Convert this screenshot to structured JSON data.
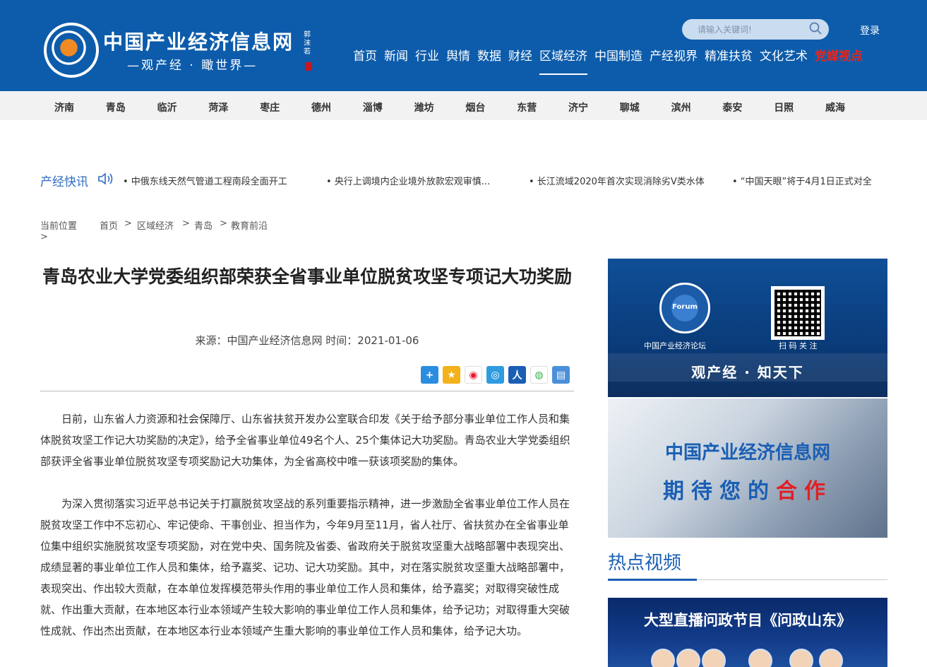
{
  "header": {
    "logo_title": "中国产业经济信息网",
    "logo_subtitle": "—观产经 · 瞰世界—",
    "logo_seal": "郭沫若",
    "search_placeholder": "请输入关键词!",
    "login": "登录",
    "nav": [
      {
        "label": "首页"
      },
      {
        "label": "新闻"
      },
      {
        "label": "行业"
      },
      {
        "label": "舆情"
      },
      {
        "label": "数据"
      },
      {
        "label": "财经"
      },
      {
        "label": "区域经济",
        "active": true
      },
      {
        "label": "中国制造"
      },
      {
        "label": "产经视界"
      },
      {
        "label": "精准扶贫"
      },
      {
        "label": "文化艺术"
      },
      {
        "label": "党媒视点",
        "hot": true
      }
    ]
  },
  "subnav": [
    "济南",
    "青岛",
    "临沂",
    "菏泽",
    "枣庄",
    "德州",
    "淄博",
    "潍坊",
    "烟台",
    "东营",
    "济宁",
    "聊城",
    "滨州",
    "泰安",
    "日照",
    "威海"
  ],
  "ticker": {
    "label": "产经快讯",
    "items": [
      "• 中俄东线天然气管道工程南段全面开工",
      "• 央行上调境内企业境外放款宏观审慎...",
      "• 长江流域2020年首次实现消除劣Ⅴ类水体",
      "• “中国天眼”将于4月1日正式对全"
    ]
  },
  "breadcrumb": {
    "label": "当前位置",
    "items": [
      "首页",
      ">",
      "区域经济",
      ">",
      "青岛",
      ">",
      "教育前沿"
    ],
    "trailing": ">"
  },
  "article": {
    "title": "青岛农业大学党委组织部荣获全省事业单位脱贫攻坚专项记大功奖励",
    "meta": "来源：中国产业经济信息网   时间：2021-01-06",
    "share_icons": [
      "plus-icon",
      "star-icon",
      "weibo-icon",
      "tencent-icon",
      "renren-icon",
      "wechat-icon",
      "print-icon"
    ],
    "paragraphs": [
      "日前，山东省人力资源和社会保障厅、山东省扶贫开发办公室联合印发《关于给予部分事业单位工作人员和集体脱贫攻坚工作记大功奖励的决定》，给予全省事业单位49名个人、25个集体记大功奖励。青岛农业大学党委组织部获评全省事业单位脱贫攻坚专项奖励记大功集体，为全省高校中唯一获该项奖励的集体。",
      "为深入贯彻落实习近平总书记关于打赢脱贫攻坚战的系列重要指示精神，进一步激励全省事业单位工作人员在脱贫攻坚工作中不忘初心、牢记使命、干事创业、担当作为，今年9月至11月，省人社厅、省扶贫办在全省事业单位集中组织实施脱贫攻坚专项奖励，对在党中央、国务院及省委、省政府关于脱贫攻坚重大战略部署中表现突出、成绩显著的事业单位工作人员和集体，给予嘉奖、记功、记大功奖励。其中，对在落实脱贫攻坚重大战略部署中，表现突出、作出较大贡献，在本单位发挥模范带头作用的事业单位工作人员和集体，给予嘉奖；对取得突破性成就、作出重大贡献，在本地区本行业本领域产生较大影响的事业单位工作人员和集体，给予记功；对取得重大突破性成就、作出杰出贡献，在本地区本行业本领域产生重大影响的事业单位工作人员和集体，给予记大功。"
    ]
  },
  "sidebar": {
    "ad1": {
      "forum_label": "中国产业经济论坛",
      "globe_text": "Forum",
      "qr_label": "扫 码 关 注",
      "slogan": "观产经 · 知天下"
    },
    "ad2": {
      "title": "中国产业经济信息网",
      "slogan_blue": "期待您的",
      "slogan_red": "合作"
    },
    "hot_video_title": "热点视频",
    "video": {
      "title": "大型直播问政节目《问政山东》"
    }
  }
}
